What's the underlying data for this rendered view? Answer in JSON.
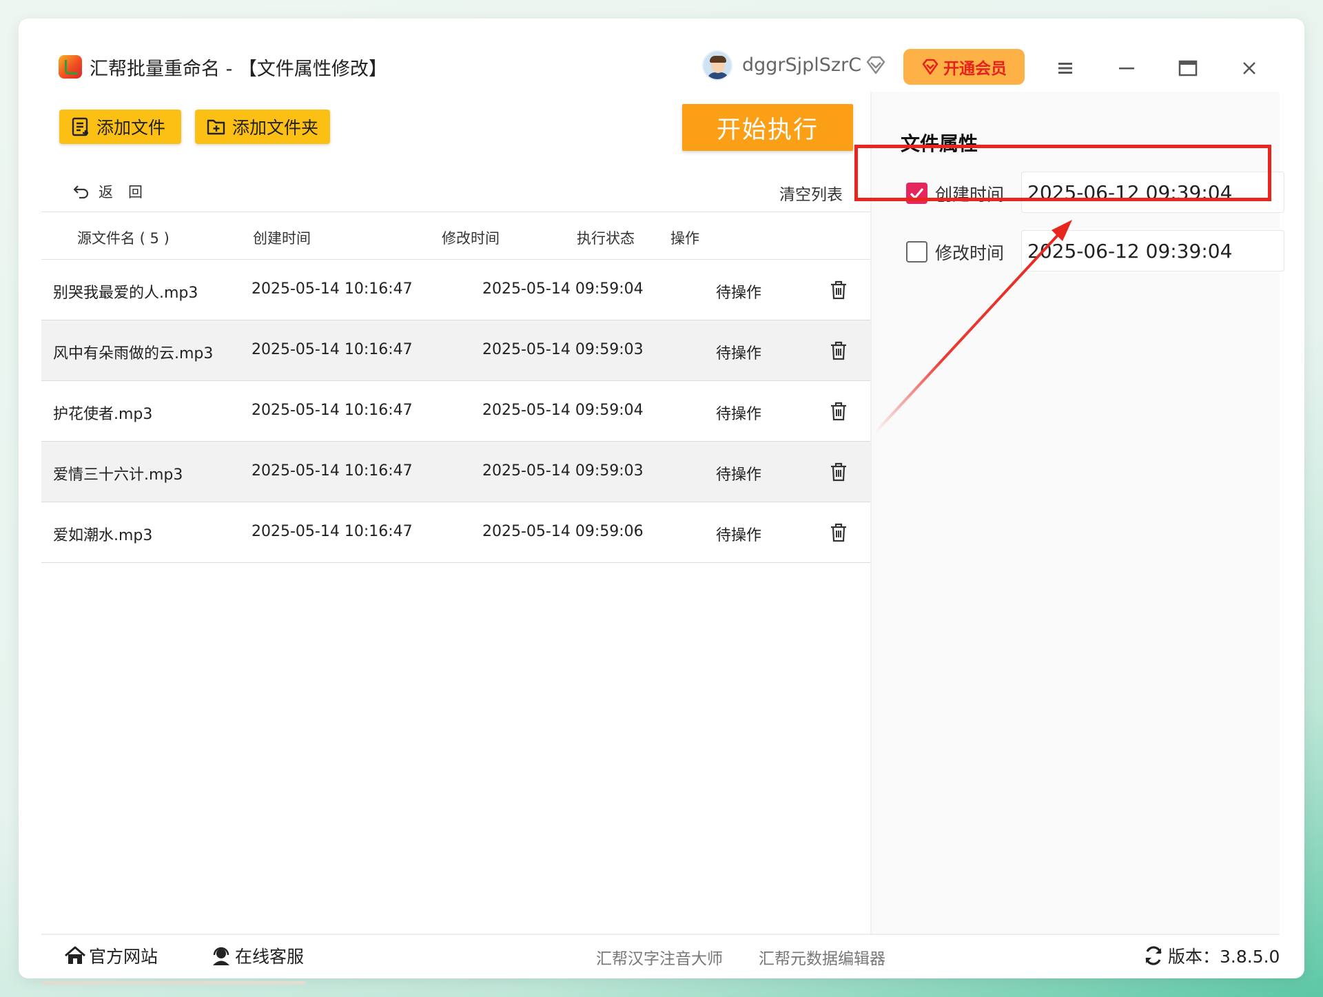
{
  "window": {
    "title": "汇帮批量重命名 - 【文件属性修改】",
    "username": "dggrSjplSzrC",
    "vip_label": "开通会员"
  },
  "toolbar": {
    "add_file_label": "添加文件",
    "add_folder_label": "添加文件夹",
    "start_label": "开始执行",
    "back_label": "返回",
    "clear_label": "清空列表"
  },
  "table": {
    "headers": [
      "源文件名 ( 5 )",
      "创建时间",
      "修改时间",
      "执行状态",
      "操作"
    ],
    "rows": [
      {
        "name": "别哭我最爱的人.mp3",
        "created": "2025-05-14 10:16:47",
        "modified": "2025-05-14 09:59:04",
        "status": "待操作"
      },
      {
        "name": "风中有朵雨做的云.mp3",
        "created": "2025-05-14 10:16:47",
        "modified": "2025-05-14 09:59:03",
        "status": "待操作"
      },
      {
        "name": "护花使者.mp3",
        "created": "2025-05-14 10:16:47",
        "modified": "2025-05-14 09:59:04",
        "status": "待操作"
      },
      {
        "name": "爱情三十六计.mp3",
        "created": "2025-05-14 10:16:47",
        "modified": "2025-05-14 09:59:03",
        "status": "待操作"
      },
      {
        "name": "爱如潮水.mp3",
        "created": "2025-05-14 10:16:47",
        "modified": "2025-05-14 09:59:06",
        "status": "待操作"
      }
    ]
  },
  "properties": {
    "title": "文件属性",
    "created": {
      "label": "创建时间",
      "checked": true,
      "value": "2025-06-12 09:39:04"
    },
    "modified": {
      "label": "修改时间",
      "checked": false,
      "value": "2025-06-12 09:39:04"
    }
  },
  "footer": {
    "website_label": "官方网站",
    "support_label": "在线客服",
    "ext_link_1": "汇帮汉字注音大师",
    "ext_link_2": "汇帮元数据编辑器",
    "version_label": "版本：3.8.5.0"
  },
  "colors": {
    "accent_yellow": "#fcc014",
    "start_orange": "#fb9f16",
    "checkbox_pink": "#e5275e",
    "annotation_red": "#e8261e"
  },
  "icons": [
    "app-logo-icon",
    "avatar-icon",
    "diamond-icon",
    "menu-icon",
    "minimize-icon",
    "maximize-icon",
    "close-icon",
    "add-file-icon",
    "add-folder-icon",
    "back-arrow-icon",
    "trash-icon",
    "home-icon",
    "headset-icon",
    "refresh-icon"
  ]
}
